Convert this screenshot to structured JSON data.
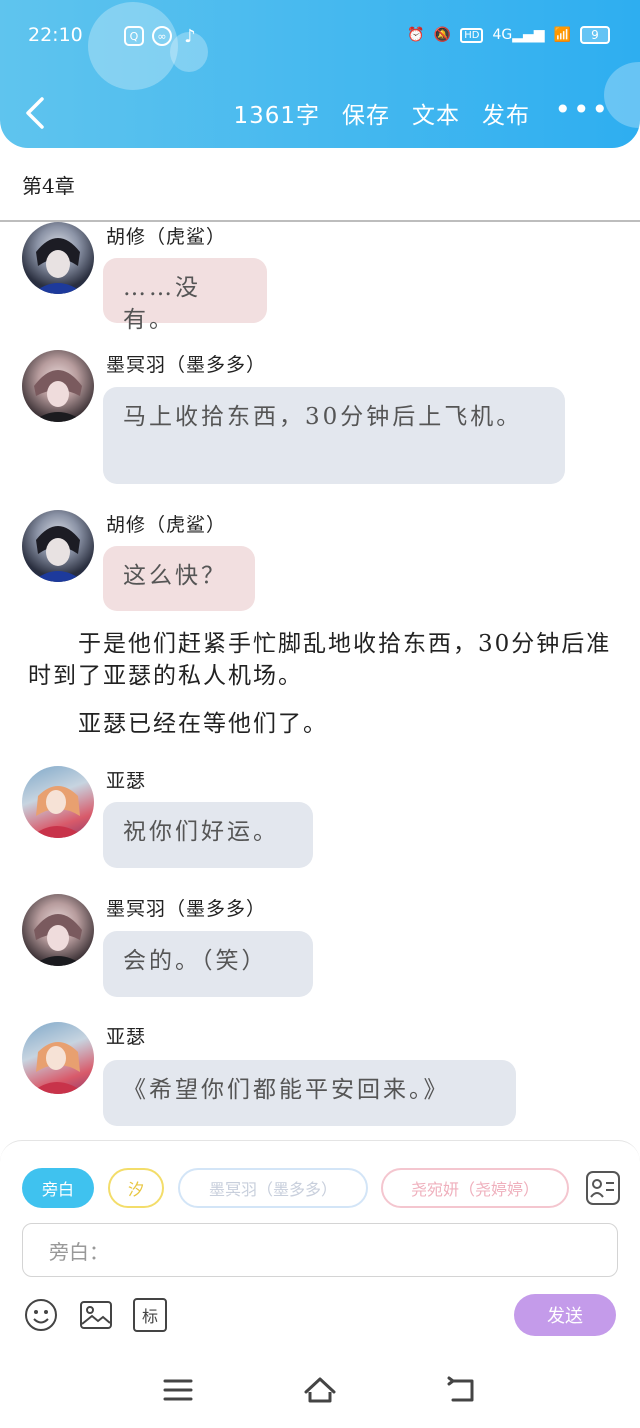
{
  "status_bar": {
    "time": "22:10",
    "app_icons": [
      "qq-icon",
      "link-icon",
      "tiktok-icon"
    ],
    "network": "4G",
    "battery": "9"
  },
  "header": {
    "word_count": "1361字",
    "save": "保存",
    "text": "文本",
    "publish": "发布"
  },
  "chapter_title": "第4章",
  "messages": [
    {
      "speaker": "胡修（虎鲨）",
      "text": "……没有。",
      "color": "pink"
    },
    {
      "speaker": "墨冥羽（墨多多）",
      "text": "马上收拾东西，30分钟后上飞机。",
      "color": "blue"
    },
    {
      "speaker": "胡修（虎鲨）",
      "text": "这么快？",
      "color": "pink"
    },
    {
      "narration": "　　于是他们赶紧手忙脚乱地收拾东西，30分钟后准时到了亚瑟的私人机场。"
    },
    {
      "narration": "　　亚瑟已经在等他们了。"
    },
    {
      "speaker": "亚瑟",
      "text": "祝你们好运。",
      "color": "blue"
    },
    {
      "speaker": "墨冥羽（墨多多）",
      "text": "会的。（笑）",
      "color": "blue"
    },
    {
      "speaker": "亚瑟",
      "text": "《希望你们都能平安回来。》",
      "color": "blue"
    }
  ],
  "role_chips": [
    "旁白",
    "汐",
    "墨冥羽（墨多多）",
    "尧宛妍（尧婷婷）"
  ],
  "input": {
    "placeholder": "旁白："
  },
  "tools": {
    "tag_label": "标"
  },
  "send_label": "发送",
  "colors": {
    "header": "#2eaef0",
    "pink_bubble": "#f2dfe0",
    "blue_bubble": "#e3e7ee",
    "send": "#c49bea",
    "chip_active": "#3fc2ef"
  }
}
